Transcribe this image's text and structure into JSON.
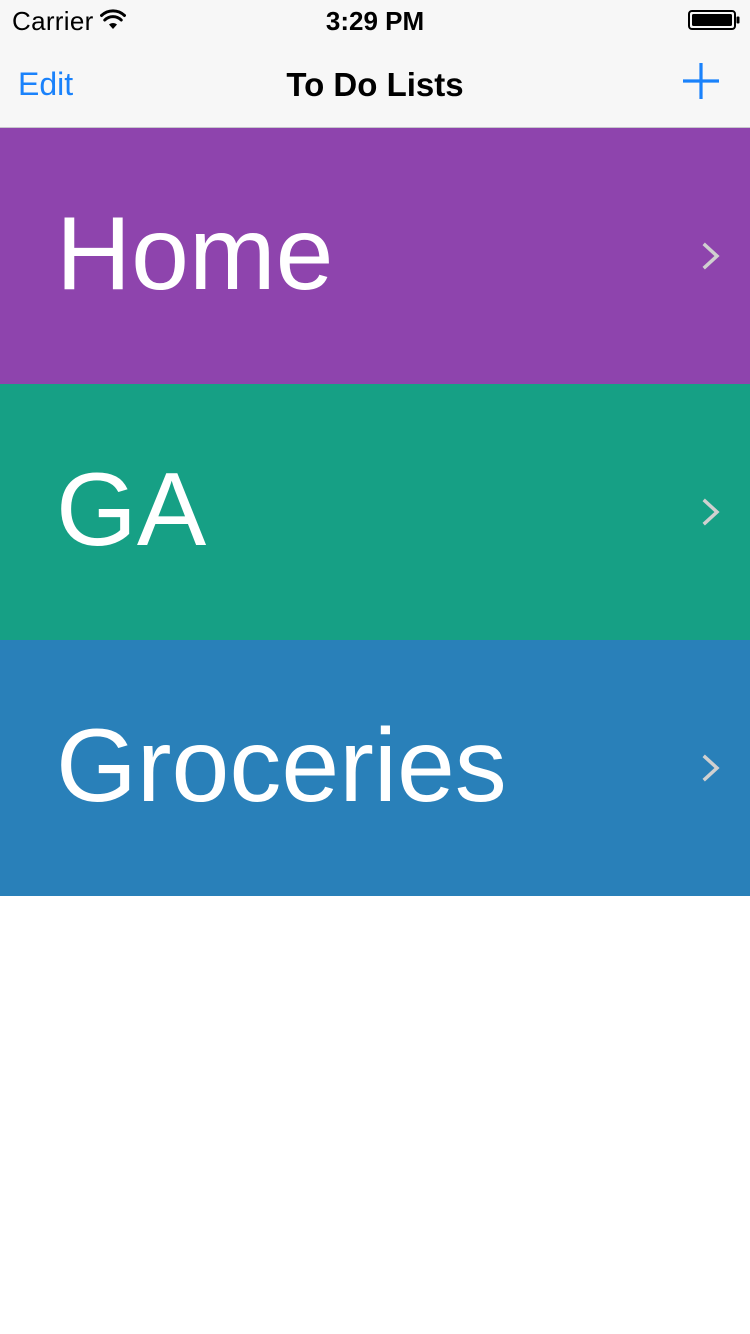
{
  "status_bar": {
    "carrier": "Carrier",
    "time": "3:29 PM",
    "wifi_icon": "wifi-icon",
    "battery_icon": "battery-full-icon"
  },
  "nav_bar": {
    "edit_label": "Edit",
    "title": "To Do Lists",
    "add_icon": "plus-icon"
  },
  "lists": [
    {
      "name": "Home",
      "color": "#8e44ad",
      "chevron_icon": "chevron-right-icon"
    },
    {
      "name": "GA",
      "color": "#16a085",
      "chevron_icon": "chevron-right-icon"
    },
    {
      "name": "Groceries",
      "color": "#2980b9",
      "chevron_icon": "chevron-right-icon"
    }
  ],
  "colors": {
    "tint": "#1a82fb",
    "bar_background": "#f7f7f7",
    "chevron": "#d0d0d0"
  }
}
